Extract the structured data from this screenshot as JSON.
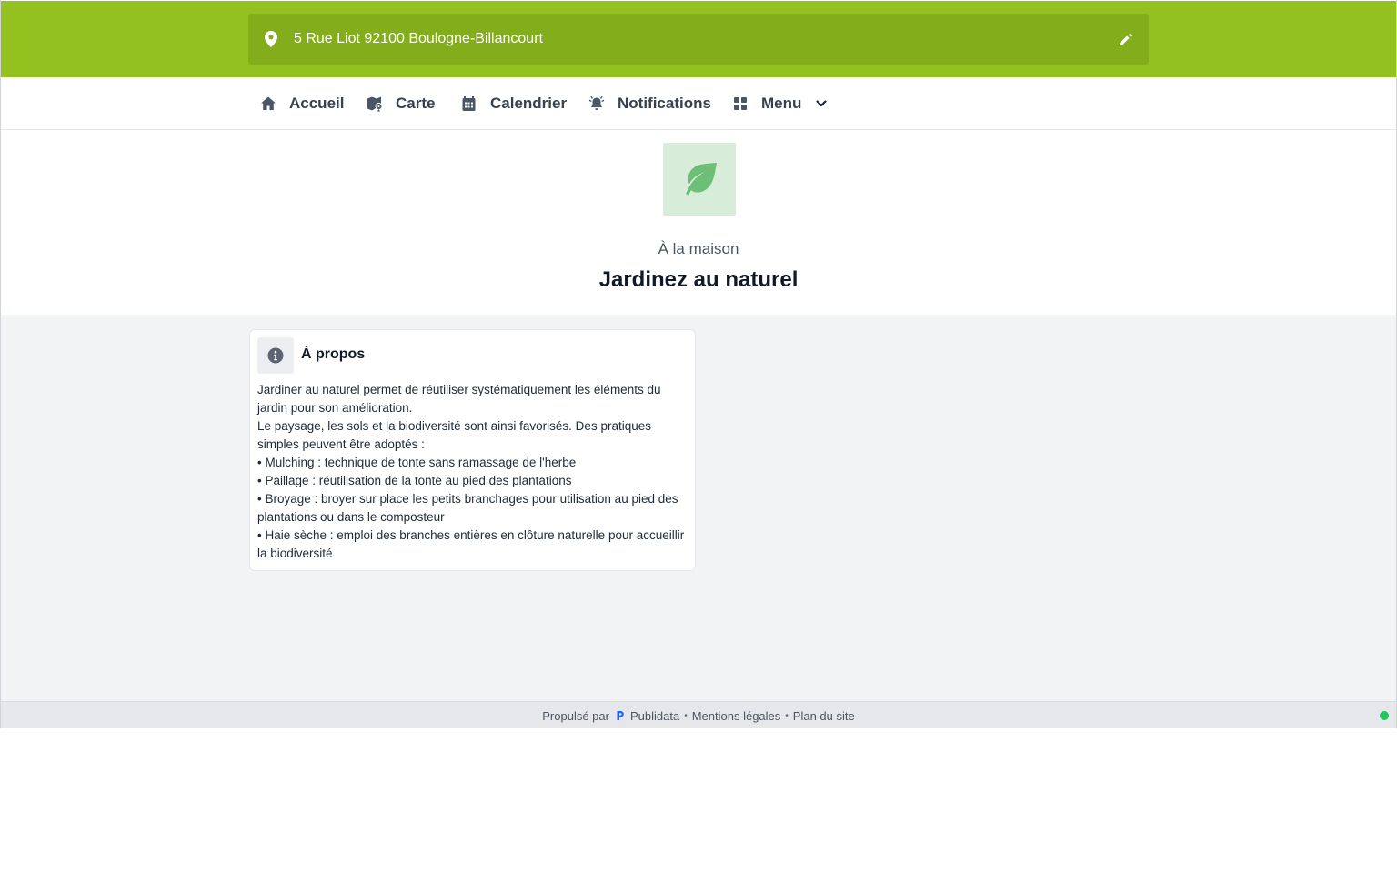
{
  "header": {
    "address": "5 Rue Liot 92100 Boulogne-Billancourt",
    "pin_icon": "map-pin-icon",
    "edit_icon": "pencil-icon",
    "color": "#93c11f"
  },
  "nav": {
    "items": [
      {
        "label": "Accueil",
        "icon": "home-icon"
      },
      {
        "label": "Carte",
        "icon": "map-icon"
      },
      {
        "label": "Calendrier",
        "icon": "calendar-icon"
      },
      {
        "label": "Notifications",
        "icon": "bell-icon"
      },
      {
        "label": "Menu",
        "icon": "grid-icon"
      }
    ]
  },
  "hero": {
    "icon": "leaf-icon",
    "category": "À la maison",
    "title": "Jardinez au naturel"
  },
  "about": {
    "icon": "info-icon",
    "title": "À propos",
    "lines": [
      "Jardiner au naturel permet de réutiliser systématiquement les éléments du jardin pour son amélioration.",
      "Le paysage, les sols et la biodiversité sont ainsi favorisés. Des pratiques simples peuvent être adoptés :",
      "• Mulching : technique de tonte sans ramassage de l'herbe",
      "• Paillage : réutilisation de la tonte au pied des plantations",
      "• Broyage : broyer sur place les petits branchages pour utilisation au pied des plantations ou dans le composteur",
      "• Haie sèche : emploi des branches entières en clôture naturelle pour accueillir la biodiversité"
    ]
  },
  "footer": {
    "powered_by": "Propulsé par",
    "brand": "Publidata",
    "separator": "•",
    "legal": "Mentions légales",
    "sitemap": "Plan du site",
    "status_color": "#22c55e"
  }
}
